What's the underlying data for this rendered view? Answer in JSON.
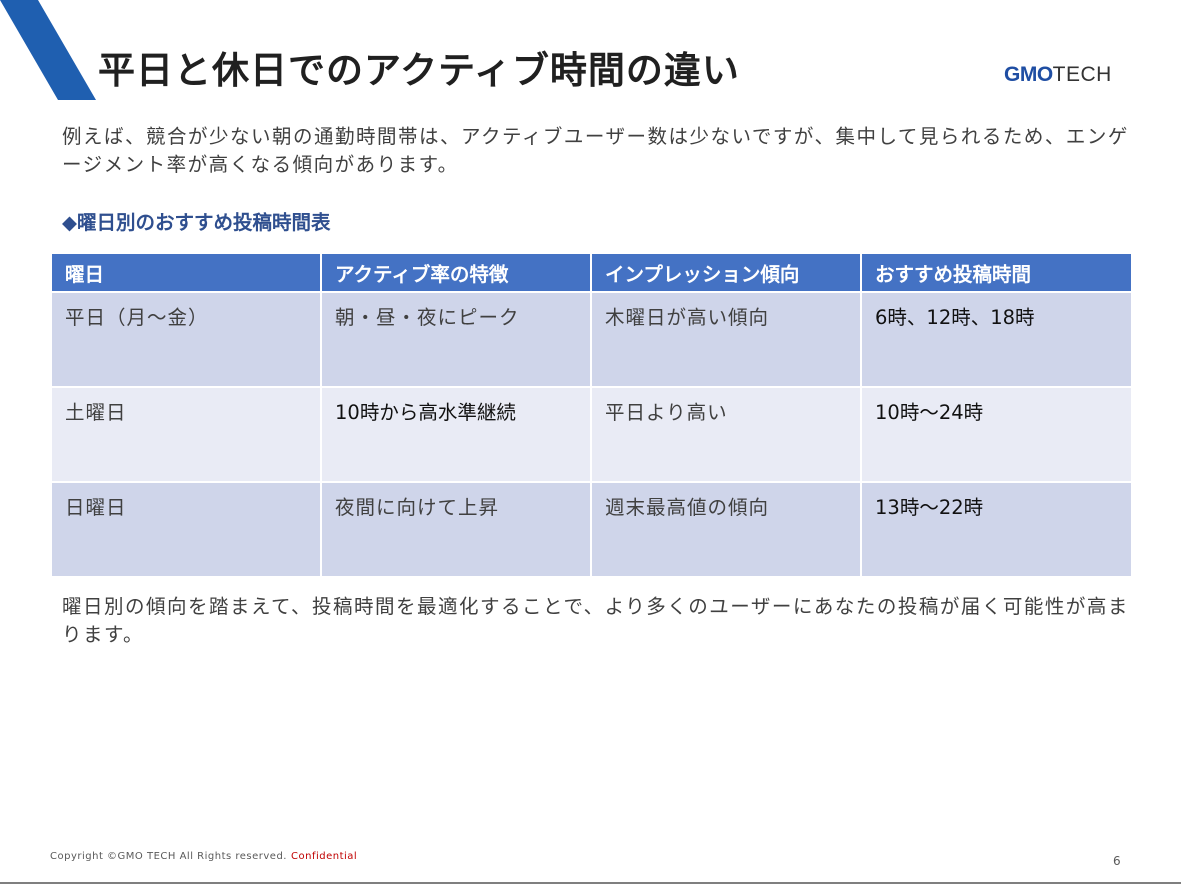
{
  "header": {
    "title": "平日と休日でのアクティブ時間の違い",
    "logo_primary": "GMO",
    "logo_secondary": "TECH"
  },
  "intro_text": "例えば、競合が少ない朝の通勤時間帯は、アクティブユーザー数は少ないですが、集中して見られるため、エンゲージメント率が高くなる傾向があります。",
  "section_heading": "◆曜日別のおすすめ投稿時間表",
  "table": {
    "headers": [
      "曜日",
      "アクティブ率の特徴",
      "インプレッション傾向",
      "おすすめ投稿時間"
    ],
    "rows": [
      [
        "平日（月～金）",
        "朝・昼・夜にピーク",
        "木曜日が高い傾向",
        "6時、12時、18時"
      ],
      [
        "土曜日",
        "10時から高水準継続",
        "平日より高い",
        "10時～24時"
      ],
      [
        "日曜日",
        "夜間に向けて上昇",
        "週末最高値の傾向",
        "13時～22時"
      ]
    ]
  },
  "summary_text": "曜日別の傾向を踏まえて、投稿時間を最適化することで、より多くのユーザーにあなたの投稿が届く可能性が高まります。",
  "footer": {
    "copyright": "Copyright ©GMO TECH All Rights reserved.",
    "confidential": "Confidential",
    "page_number": "6"
  },
  "colors": {
    "accent_blue": "#1f5fb0",
    "header_fill": "#4472c4",
    "row_dark": "#cfd5ea",
    "row_light": "#e9ebf5",
    "confidential": "#c00000"
  }
}
